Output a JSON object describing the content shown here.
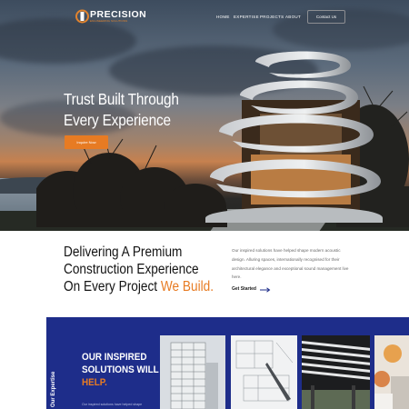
{
  "brand": {
    "name": "PRECISION",
    "tagline": "ENGINEERING SOLUTIONS",
    "accent_color": "#e77b23",
    "panel_color": "#1e2d8a"
  },
  "nav": {
    "items": [
      "HOME",
      "EXPERTISE",
      "PROJECTS",
      "ABOUT"
    ],
    "contact_label": "Contact Us"
  },
  "hero": {
    "title_line1": "Trust Built Through",
    "title_line2": "Every Experience",
    "cta_label": "Inquire Now"
  },
  "intro": {
    "heading_line1": "Delivering A Premium",
    "heading_line2": "Construction Experience",
    "heading_line3_prefix": "On Every Project ",
    "heading_line3_highlight": "We Build.",
    "paragraph": "Our inspired solutions have helped shape modern acoustic design. Alluring spaces, internationally recognised for their architectural elegance and exceptional sound management live here.",
    "link_label": "Get Started"
  },
  "expertise": {
    "side_label": "Our Expertise",
    "title_line1": "OUR INSPIRED",
    "title_line2": "SOLUTIONS WILL",
    "title_line3": "HELP.",
    "subtext": "Our inspired solutions have helped shape"
  },
  "icons": [
    "logo-mark-icon",
    "arrow-right-icon"
  ]
}
